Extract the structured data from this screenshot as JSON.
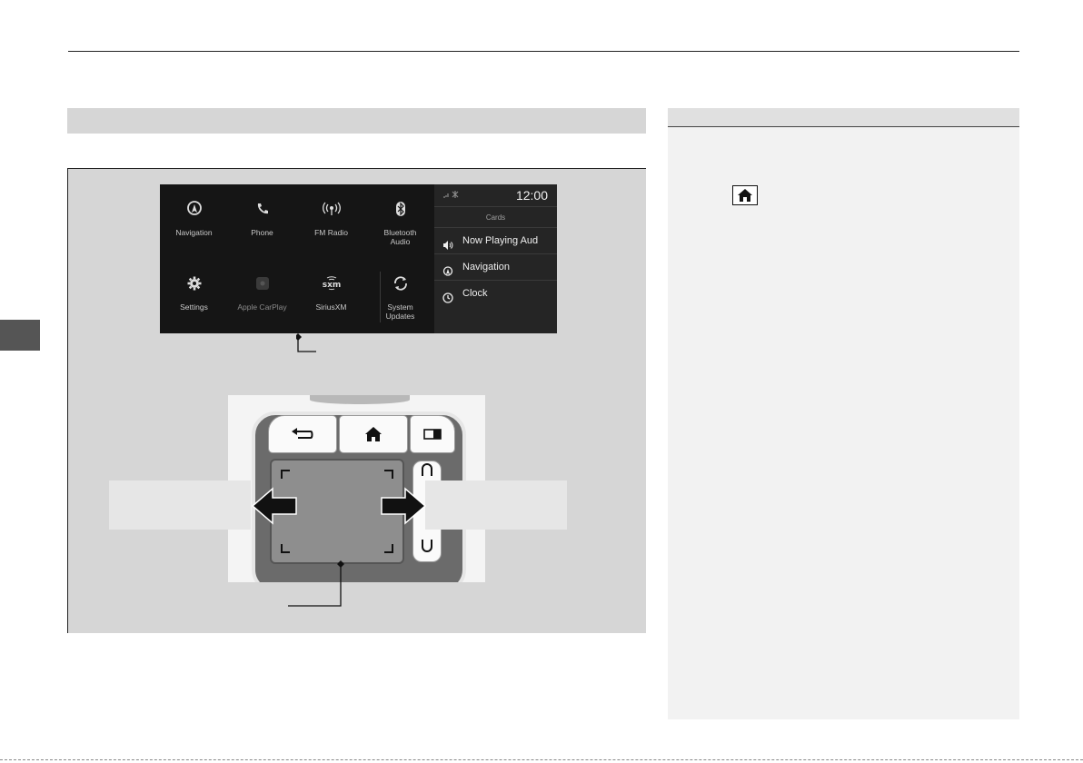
{
  "screen": {
    "apps": [
      {
        "label": "Navigation",
        "icon": "navigation-icon"
      },
      {
        "label": "Phone",
        "icon": "phone-icon"
      },
      {
        "label": "FM Radio",
        "icon": "radio-icon"
      },
      {
        "label": "Bluetooth\nAudio",
        "icon": "bluetooth-icon"
      },
      {
        "label": "Settings",
        "icon": "gear-icon"
      },
      {
        "label": "Apple CarPlay",
        "icon": "carplay-icon"
      },
      {
        "label": "SiriusXM",
        "icon": "siriusxm-icon"
      },
      {
        "label": "System\nUpdates",
        "icon": "refresh-icon"
      }
    ],
    "status": {
      "time": "12:00"
    },
    "cards": {
      "title": "Cards",
      "items": [
        {
          "label": "Now Playing Aud",
          "icon": "speaker-icon"
        },
        {
          "label": "Navigation",
          "icon": "navigation-icon"
        },
        {
          "label": "Clock",
          "icon": "clock-icon"
        }
      ]
    }
  },
  "touchpad": {
    "buttons": [
      "back-icon",
      "home-icon",
      "display-icon"
    ]
  },
  "colors": {
    "band_gray": "#d6d6d6",
    "panel_gray": "#f2f2f2",
    "screen_black": "#151515"
  }
}
